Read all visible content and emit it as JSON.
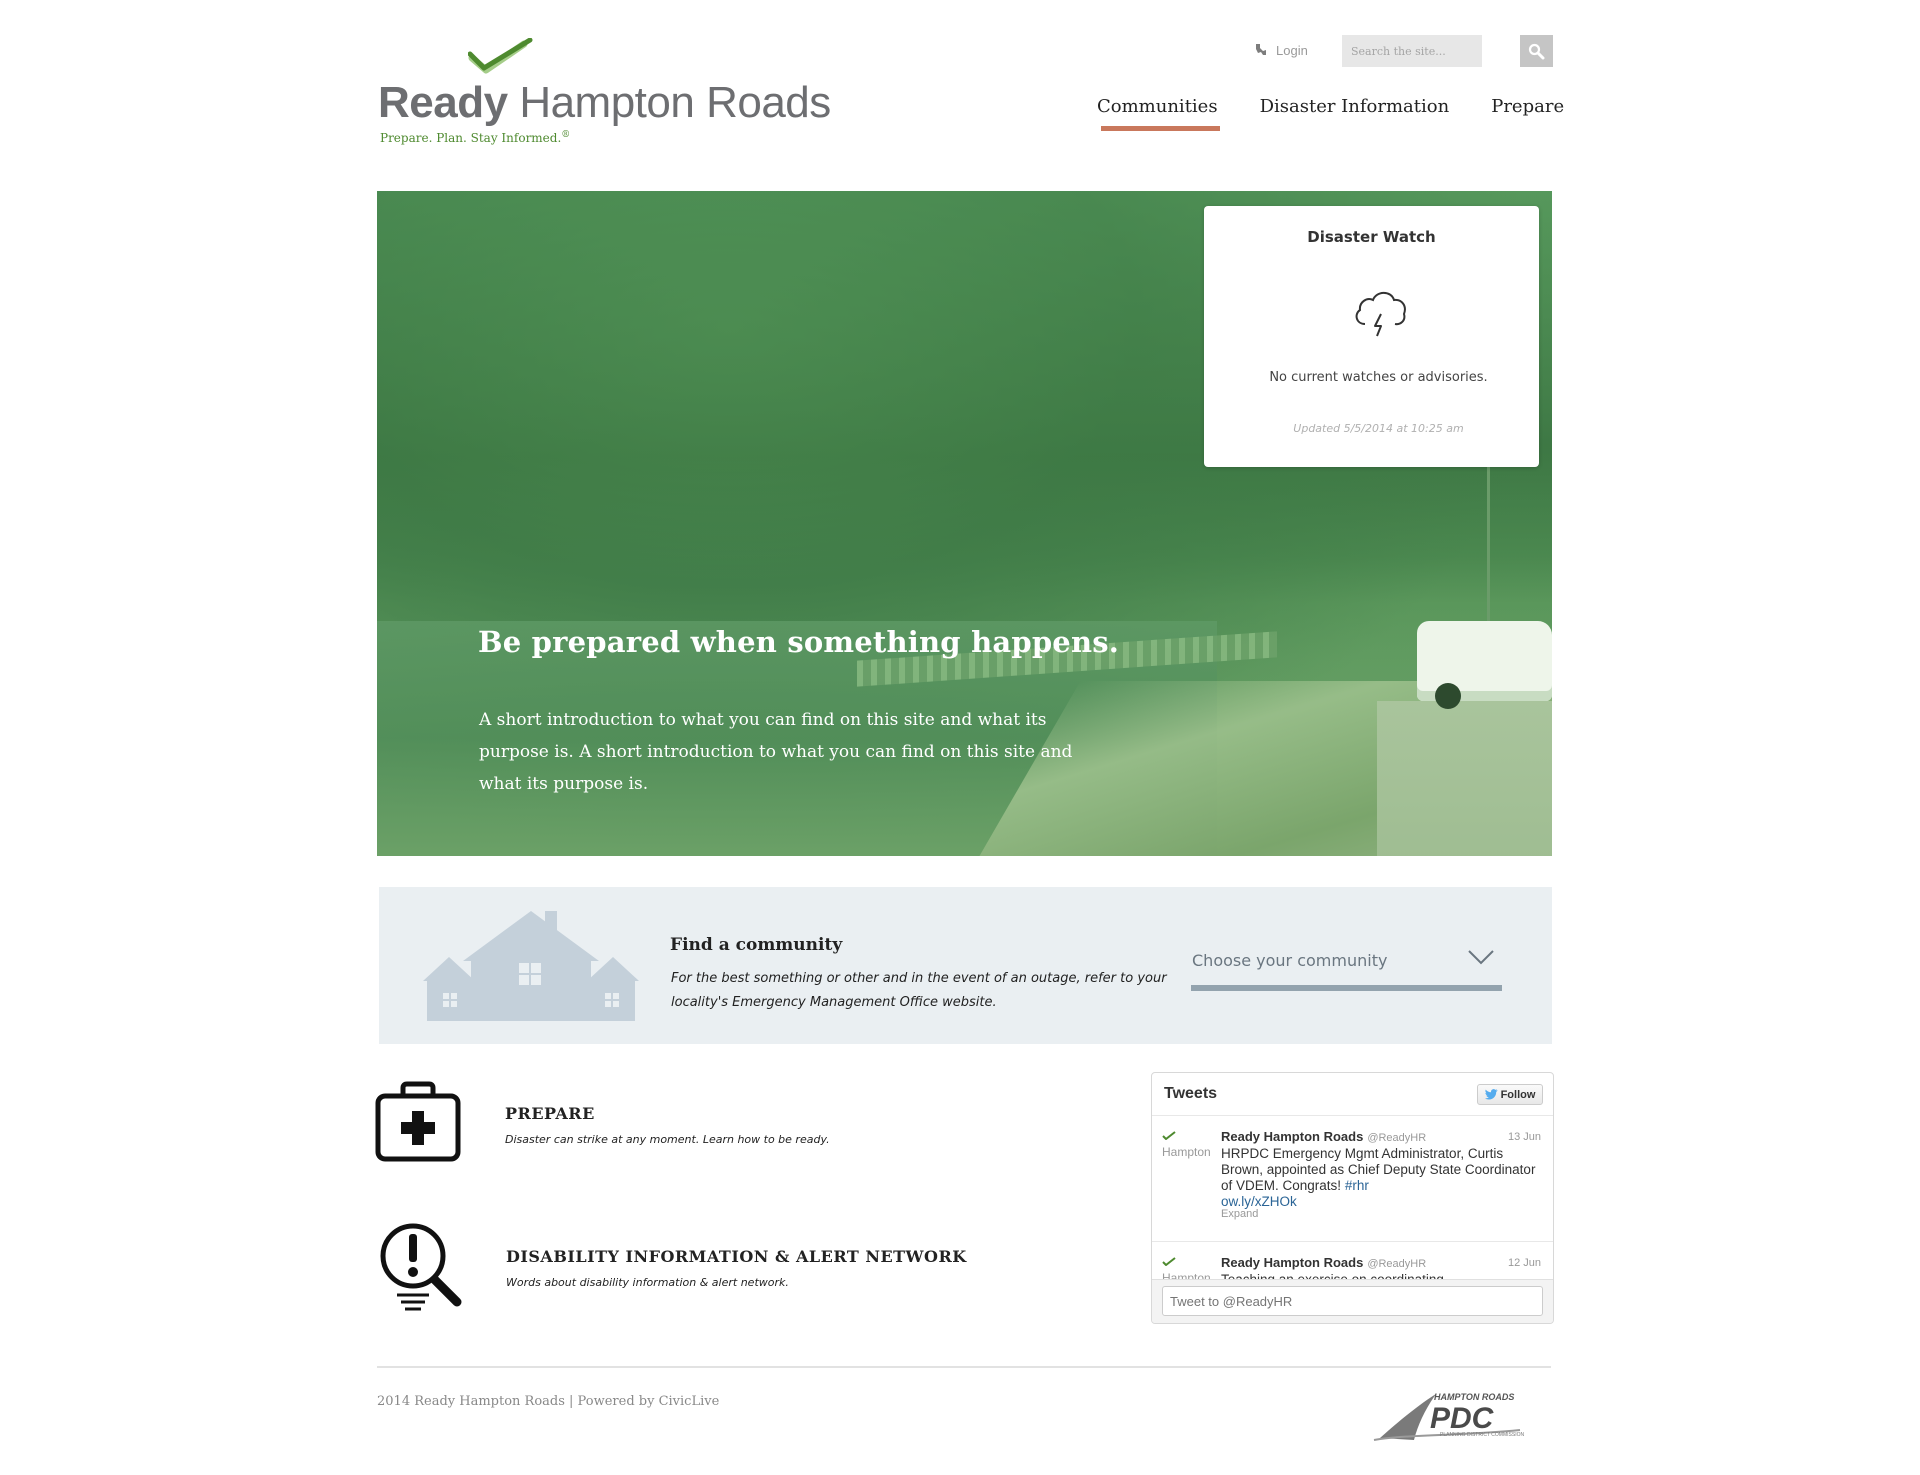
{
  "header": {
    "logo": {
      "word_bold": "Ready",
      "word_light": "Hampton Roads",
      "tagline": "Prepare. Plan. Stay Informed.",
      "tagline_mark": "®",
      "colors": {
        "check_dark": "#4e8a2f",
        "check_light": "#8fc16b",
        "text": "#6d6e71"
      }
    },
    "login": {
      "label": "Login",
      "icon": "wrench-key-icon"
    },
    "search": {
      "placeholder": "Search the site...",
      "button_icon": "search-icon"
    },
    "nav": [
      {
        "label": "Communities",
        "active": true
      },
      {
        "label": "Disaster Information",
        "active": false
      },
      {
        "label": "Prepare",
        "active": false
      }
    ],
    "nav_accent": "#c9785c"
  },
  "hero": {
    "title": "Be prepared when something happens.",
    "intro": "A short introduction to what you can find on this site and what its purpose is. A short introduction to what you can find on this site and what its purpose is.",
    "overlay_color": "#4f9a54"
  },
  "disaster_watch": {
    "title": "Disaster Watch",
    "icon": "storm-cloud-icon",
    "status": "No current watches or advisories.",
    "updated": "Updated 5/5/2014 at 10:25 am"
  },
  "community": {
    "icon": "houses-icon",
    "title": "Find a community",
    "description": "For the best something or other and in the event of an outage, refer to your locality's Emergency Management Office website.",
    "select_label": "Choose your community",
    "background": "#eaeff2"
  },
  "features": [
    {
      "icon": "first-aid-kit-icon",
      "title": "PREPARE",
      "description": "Disaster can strike at any moment. Learn how to be ready."
    },
    {
      "icon": "alert-magnifier-icon",
      "title": "DISABILITY INFORMATION & ALERT NETWORK",
      "description": "Words about disability information & alert network."
    }
  ],
  "twitter": {
    "title": "Tweets",
    "follow_label": "Follow",
    "tweets": [
      {
        "avatar_text": "Hampton",
        "author": "Ready Hampton Roads",
        "handle": "@ReadyHR",
        "date": "13 Jun",
        "text": "HRPDC Emergency Mgmt Administrator, Curtis Brown, appointed as Chief Deputy State Coordinator of VDEM. Congrats!",
        "hashtag": "#rhr",
        "link": "ow.ly/xZHOk",
        "expand": "Expand"
      },
      {
        "avatar_text": "Hampton",
        "author": "Ready Hampton Roads",
        "handle": "@ReadyHR",
        "date": "12 Jun",
        "text": "Teaching an exercise on coordinating"
      }
    ],
    "compose_placeholder": "Tweet to @ReadyHR"
  },
  "footer": {
    "copyright": "2014 Ready Hampton Roads | Powered by CivicLive",
    "partner_logo": {
      "top": "HAMPTON ROADS",
      "main": "PDC",
      "sub": "PLANNING DISTRICT COMMISSION"
    }
  }
}
